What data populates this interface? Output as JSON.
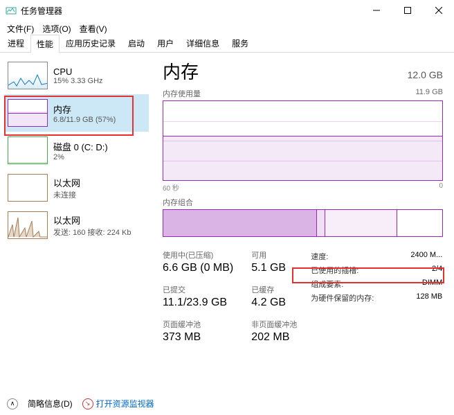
{
  "window": {
    "title": "任务管理器"
  },
  "menu": {
    "file": "文件(F)",
    "options": "选项(O)",
    "view": "查看(V)"
  },
  "tabs": [
    "进程",
    "性能",
    "应用历史记录",
    "启动",
    "用户",
    "详细信息",
    "服务"
  ],
  "sidebar": {
    "items": [
      {
        "name": "CPU",
        "detail": "15% 3.33 GHz"
      },
      {
        "name": "内存",
        "detail": "6.8/11.9 GB (57%)"
      },
      {
        "name": "磁盘 0 (C: D:)",
        "detail": "2%"
      },
      {
        "name": "以太网",
        "detail": "未连接"
      },
      {
        "name": "以太网",
        "detail": "发送: 160 接收: 224 Kb"
      }
    ]
  },
  "main": {
    "title": "内存",
    "total": "12.0 GB",
    "usage_label": "内存使用量",
    "usage_max": "11.9 GB",
    "axis_left": "60 秒",
    "axis_right": "0",
    "comp_label": "内存组合",
    "stats": {
      "in_use_label": "使用中(已压缩)",
      "in_use": "6.6 GB (0 MB)",
      "avail_label": "可用",
      "avail": "5.1 GB",
      "committed_label": "已提交",
      "committed": "11.1/23.9 GB",
      "cached_label": "已缓存",
      "cached": "4.2 GB",
      "paged_label": "页面缓冲池",
      "paged": "373 MB",
      "nonpaged_label": "非页面缓冲池",
      "nonpaged": "202 MB"
    },
    "props": {
      "speed_label": "速度:",
      "speed": "2400 M...",
      "slots_label": "已使用的插槽:",
      "slots": "2/4",
      "form_label": "组成要素:",
      "form": "DIMM",
      "reserved_label": "为硬件保留的内存:",
      "reserved": "128 MB"
    }
  },
  "footer": {
    "brief": "简略信息(D)",
    "resmon": "打开资源监视器"
  }
}
